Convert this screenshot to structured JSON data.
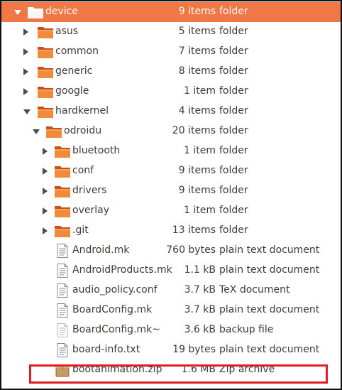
{
  "accent": "#f07746",
  "highlight_color": "#e01c24",
  "rows": [
    {
      "name": "device",
      "size": "9 items",
      "type": "folder",
      "kind": "folder",
      "depth": 0,
      "expander": "expanded",
      "selected": true
    },
    {
      "name": "asus",
      "size": "5 items",
      "type": "folder",
      "kind": "folder",
      "depth": 1,
      "expander": "collapsed"
    },
    {
      "name": "common",
      "size": "7 items",
      "type": "folder",
      "kind": "folder",
      "depth": 1,
      "expander": "collapsed"
    },
    {
      "name": "generic",
      "size": "8 items",
      "type": "folder",
      "kind": "folder",
      "depth": 1,
      "expander": "collapsed"
    },
    {
      "name": "google",
      "size": "1 item",
      "type": "folder",
      "kind": "folder",
      "depth": 1,
      "expander": "collapsed"
    },
    {
      "name": "hardkernel",
      "size": "4 items",
      "type": "folder",
      "kind": "folder",
      "depth": 1,
      "expander": "expanded"
    },
    {
      "name": "odroidu",
      "size": "20 items",
      "type": "folder",
      "kind": "folder",
      "depth": 2,
      "expander": "expanded"
    },
    {
      "name": "bluetooth",
      "size": "1 item",
      "type": "folder",
      "kind": "folder",
      "depth": 3,
      "expander": "collapsed"
    },
    {
      "name": "conf",
      "size": "9 items",
      "type": "folder",
      "kind": "folder",
      "depth": 3,
      "expander": "collapsed"
    },
    {
      "name": "drivers",
      "size": "9 items",
      "type": "folder",
      "kind": "folder",
      "depth": 3,
      "expander": "collapsed"
    },
    {
      "name": "overlay",
      "size": "1 item",
      "type": "folder",
      "kind": "folder",
      "depth": 3,
      "expander": "collapsed"
    },
    {
      "name": ".git",
      "size": "13 items",
      "type": "folder",
      "kind": "folder",
      "depth": 3,
      "expander": "collapsed"
    },
    {
      "name": "Android.mk",
      "size": "760 bytes",
      "type": "plain text document",
      "kind": "text-file",
      "depth": 3,
      "expander": "none"
    },
    {
      "name": "AndroidProducts.mk",
      "size": "1.1 kB",
      "type": "plain text document",
      "kind": "text-file",
      "depth": 3,
      "expander": "none"
    },
    {
      "name": "audio_policy.conf",
      "size": "3.7 kB",
      "type": "TeX document",
      "kind": "text-file",
      "depth": 3,
      "expander": "none"
    },
    {
      "name": "BoardConfig.mk",
      "size": "3.7 kB",
      "type": "plain text document",
      "kind": "text-file",
      "depth": 3,
      "expander": "none"
    },
    {
      "name": "BoardConfig.mk~",
      "size": "3.6 kB",
      "type": "backup file",
      "kind": "backup-file",
      "depth": 3,
      "expander": "none"
    },
    {
      "name": "board-info.txt",
      "size": "19 bytes",
      "type": "plain text document",
      "kind": "text-file",
      "depth": 3,
      "expander": "none"
    },
    {
      "name": "bootanimation.zip",
      "size": "1.6 MB",
      "type": "Zip archive",
      "kind": "zip-file",
      "depth": 3,
      "expander": "none",
      "highlighted": true
    }
  ]
}
